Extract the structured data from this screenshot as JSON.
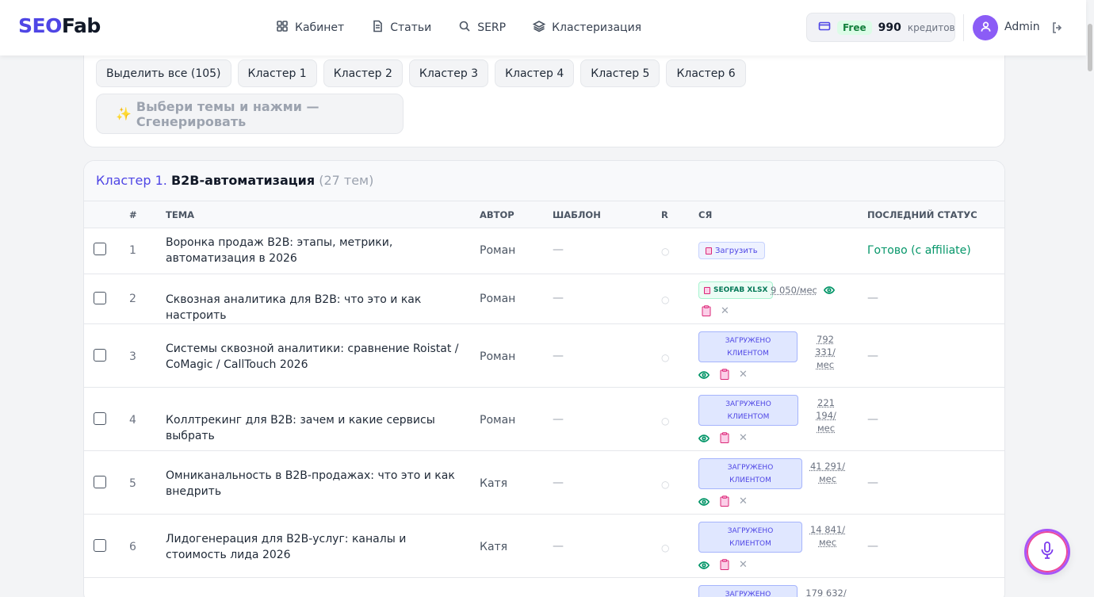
{
  "brand": {
    "seo": "SEO",
    "fab": "Fab"
  },
  "nav": [
    {
      "label": "Кабинет",
      "icon": "grid-icon"
    },
    {
      "label": "Статьи",
      "icon": "document-icon"
    },
    {
      "label": "SERP",
      "icon": "search-icon"
    },
    {
      "label": "Кластеризация",
      "icon": "layers-icon"
    }
  ],
  "credits": {
    "plan": "Free",
    "count": "990",
    "unit": "кредитов"
  },
  "user": {
    "name": "Admin"
  },
  "filters": {
    "chips": [
      "Выделить все (105)",
      "Кластер 1",
      "Кластер 2",
      "Кластер 3",
      "Кластер 4",
      "Кластер 5",
      "Кластер 6"
    ],
    "generate_label": "Выбери темы и нажми — Сгенерировать",
    "generate_icon": "✨"
  },
  "cluster": {
    "num": "Кластер 1.",
    "name": "B2B-автоматизация",
    "count": "(27 тем)"
  },
  "table": {
    "headers": [
      "#",
      "Тема",
      "Автор",
      "Шаблон",
      "R",
      "СЯ",
      "Последний статус"
    ],
    "rows": [
      {
        "idx": "1",
        "topic": "Воронка продаж B2B: этапы, метрики, автоматизация в 2026",
        "author": "Роман",
        "tpl": "—",
        "r": "○",
        "sya": "Загрузить",
        "status": "Готово (с affiliate)"
      },
      {
        "idx": "2",
        "topic": "Сквозная аналитика для B2B: что это и как настроить",
        "author": "Роман",
        "tpl": "—",
        "r": "○",
        "sya": "SEOFAB XLSX",
        "freq": "9 050/мес",
        "status": "—"
      },
      {
        "idx": "3",
        "topic": "Системы сквозной аналитики: сравнение Roistat / CoMagic / CallTouch 2026",
        "author": "Роман",
        "tpl": "—",
        "r": "○",
        "sya1": "ЗАГРУЖЕНО",
        "sya2": "КЛИЕНТОМ",
        "freq1": "792 331/",
        "freq2": "мес",
        "status": "—"
      },
      {
        "idx": "4",
        "topic": "Коллтрекинг для B2B: зачем и какие сервисы выбрать",
        "author": "Роман",
        "tpl": "—",
        "r": "○",
        "sya1": "ЗАГРУЖЕНО",
        "sya2": "КЛИЕНТОМ",
        "freq1": "221 194/",
        "freq2": "мес",
        "status": "—"
      },
      {
        "idx": "5",
        "topic": "Омниканальность в B2B-продажах: что это и как внедрить",
        "author": "Катя",
        "tpl": "—",
        "r": "○",
        "sya1": "ЗАГРУЖЕНО",
        "sya2": "КЛИЕНТОМ",
        "freq1": "41 291/",
        "freq2": "мес",
        "status": "—"
      },
      {
        "idx": "6",
        "topic": "Лидогенерация для B2B-услуг: каналы и стоимость лида 2026",
        "author": "Катя",
        "tpl": "—",
        "r": "○",
        "sya1": "ЗАГРУЖЕНО",
        "sya2": "КЛИЕНТОМ",
        "freq1": "14 841/",
        "freq2": "мес",
        "status": "—"
      },
      {
        "sya1": "ЗАГРУЖЕНО",
        "freq1": "179 632/"
      }
    ]
  },
  "colors": {
    "accent": "#4f46e5",
    "success": "#059669"
  }
}
